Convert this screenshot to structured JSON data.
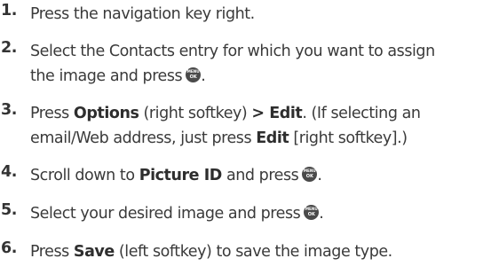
{
  "steps": [
    {
      "number": "1.",
      "text": "Press the navigation key right."
    },
    {
      "number": "2.",
      "line1": "Select the Contacts entry for which you want to assign",
      "line2": "the image and press",
      "end": "."
    },
    {
      "number": "3.",
      "pre": "Press ",
      "b1": "Options",
      "mid": " (right softkey) ",
      "b2": "> Edit",
      "post": ". (If selecting an",
      "line2a": "email/Web address, just press ",
      "b3": "Edit",
      "line2b": " [right softkey].)"
    },
    {
      "number": "4.",
      "pre": "Scroll down to ",
      "b1": "Picture ID",
      "post": " and press",
      "end": "."
    },
    {
      "number": "5.",
      "text": "Select your desired image and press",
      "end": "."
    },
    {
      "number": "6.",
      "pre": "Press ",
      "b1": "Save",
      "post": " (left softkey) to save the image type."
    }
  ],
  "icon": {
    "name": "menu-ok-key-icon",
    "top_text": "MENU",
    "bottom_text": "OK"
  }
}
